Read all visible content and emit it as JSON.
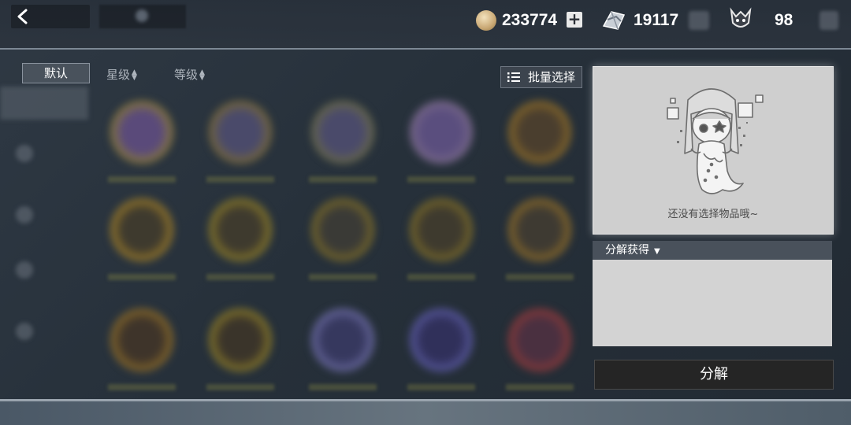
{
  "header": {
    "back_icon": "chevron-left-icon",
    "resources": [
      {
        "icon": "coin-icon",
        "value": "233774",
        "plus": "+"
      },
      {
        "icon": "crystal-icon",
        "value": "19117"
      },
      {
        "icon": "stamina-icon",
        "value": "98"
      }
    ]
  },
  "sort": {
    "default_label": "默认",
    "star_label": "星级",
    "level_label": "等级",
    "arrows": "▲▼"
  },
  "batch": {
    "label": "批量选择",
    "icon": "list-icon"
  },
  "preview": {
    "empty_text": "还没有选择物品哦~"
  },
  "decompose": {
    "header_label": "分解获得",
    "caret": "▼",
    "button_label": "分解"
  },
  "colors": {
    "accent_light": "#cfcfcf",
    "dark_button": "#252525",
    "header_bg": "#49515b"
  }
}
